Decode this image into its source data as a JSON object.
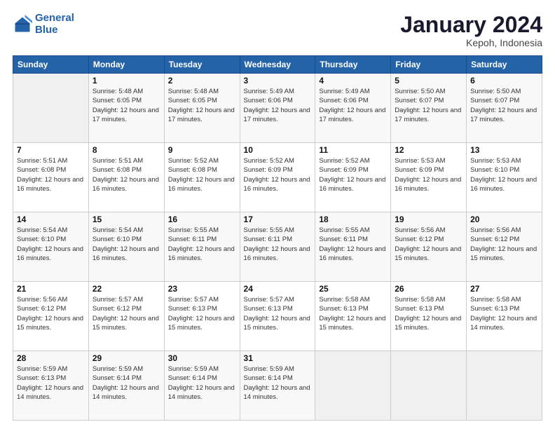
{
  "logo": {
    "line1": "General",
    "line2": "Blue"
  },
  "title": "January 2024",
  "subtitle": "Kepoh, Indonesia",
  "days_of_week": [
    "Sunday",
    "Monday",
    "Tuesday",
    "Wednesday",
    "Thursday",
    "Friday",
    "Saturday"
  ],
  "weeks": [
    [
      {
        "day": "",
        "info": ""
      },
      {
        "day": "1",
        "info": "Sunrise: 5:48 AM\nSunset: 6:05 PM\nDaylight: 12 hours\nand 17 minutes."
      },
      {
        "day": "2",
        "info": "Sunrise: 5:48 AM\nSunset: 6:05 PM\nDaylight: 12 hours\nand 17 minutes."
      },
      {
        "day": "3",
        "info": "Sunrise: 5:49 AM\nSunset: 6:06 PM\nDaylight: 12 hours\nand 17 minutes."
      },
      {
        "day": "4",
        "info": "Sunrise: 5:49 AM\nSunset: 6:06 PM\nDaylight: 12 hours\nand 17 minutes."
      },
      {
        "day": "5",
        "info": "Sunrise: 5:50 AM\nSunset: 6:07 PM\nDaylight: 12 hours\nand 17 minutes."
      },
      {
        "day": "6",
        "info": "Sunrise: 5:50 AM\nSunset: 6:07 PM\nDaylight: 12 hours\nand 17 minutes."
      }
    ],
    [
      {
        "day": "7",
        "info": "Sunrise: 5:51 AM\nSunset: 6:08 PM\nDaylight: 12 hours\nand 16 minutes."
      },
      {
        "day": "8",
        "info": "Sunrise: 5:51 AM\nSunset: 6:08 PM\nDaylight: 12 hours\nand 16 minutes."
      },
      {
        "day": "9",
        "info": "Sunrise: 5:52 AM\nSunset: 6:08 PM\nDaylight: 12 hours\nand 16 minutes."
      },
      {
        "day": "10",
        "info": "Sunrise: 5:52 AM\nSunset: 6:09 PM\nDaylight: 12 hours\nand 16 minutes."
      },
      {
        "day": "11",
        "info": "Sunrise: 5:52 AM\nSunset: 6:09 PM\nDaylight: 12 hours\nand 16 minutes."
      },
      {
        "day": "12",
        "info": "Sunrise: 5:53 AM\nSunset: 6:09 PM\nDaylight: 12 hours\nand 16 minutes."
      },
      {
        "day": "13",
        "info": "Sunrise: 5:53 AM\nSunset: 6:10 PM\nDaylight: 12 hours\nand 16 minutes."
      }
    ],
    [
      {
        "day": "14",
        "info": "Sunrise: 5:54 AM\nSunset: 6:10 PM\nDaylight: 12 hours\nand 16 minutes."
      },
      {
        "day": "15",
        "info": "Sunrise: 5:54 AM\nSunset: 6:10 PM\nDaylight: 12 hours\nand 16 minutes."
      },
      {
        "day": "16",
        "info": "Sunrise: 5:55 AM\nSunset: 6:11 PM\nDaylight: 12 hours\nand 16 minutes."
      },
      {
        "day": "17",
        "info": "Sunrise: 5:55 AM\nSunset: 6:11 PM\nDaylight: 12 hours\nand 16 minutes."
      },
      {
        "day": "18",
        "info": "Sunrise: 5:55 AM\nSunset: 6:11 PM\nDaylight: 12 hours\nand 16 minutes."
      },
      {
        "day": "19",
        "info": "Sunrise: 5:56 AM\nSunset: 6:12 PM\nDaylight: 12 hours\nand 15 minutes."
      },
      {
        "day": "20",
        "info": "Sunrise: 5:56 AM\nSunset: 6:12 PM\nDaylight: 12 hours\nand 15 minutes."
      }
    ],
    [
      {
        "day": "21",
        "info": "Sunrise: 5:56 AM\nSunset: 6:12 PM\nDaylight: 12 hours\nand 15 minutes."
      },
      {
        "day": "22",
        "info": "Sunrise: 5:57 AM\nSunset: 6:12 PM\nDaylight: 12 hours\nand 15 minutes."
      },
      {
        "day": "23",
        "info": "Sunrise: 5:57 AM\nSunset: 6:13 PM\nDaylight: 12 hours\nand 15 minutes."
      },
      {
        "day": "24",
        "info": "Sunrise: 5:57 AM\nSunset: 6:13 PM\nDaylight: 12 hours\nand 15 minutes."
      },
      {
        "day": "25",
        "info": "Sunrise: 5:58 AM\nSunset: 6:13 PM\nDaylight: 12 hours\nand 15 minutes."
      },
      {
        "day": "26",
        "info": "Sunrise: 5:58 AM\nSunset: 6:13 PM\nDaylight: 12 hours\nand 15 minutes."
      },
      {
        "day": "27",
        "info": "Sunrise: 5:58 AM\nSunset: 6:13 PM\nDaylight: 12 hours\nand 14 minutes."
      }
    ],
    [
      {
        "day": "28",
        "info": "Sunrise: 5:59 AM\nSunset: 6:13 PM\nDaylight: 12 hours\nand 14 minutes."
      },
      {
        "day": "29",
        "info": "Sunrise: 5:59 AM\nSunset: 6:14 PM\nDaylight: 12 hours\nand 14 minutes."
      },
      {
        "day": "30",
        "info": "Sunrise: 5:59 AM\nSunset: 6:14 PM\nDaylight: 12 hours\nand 14 minutes."
      },
      {
        "day": "31",
        "info": "Sunrise: 5:59 AM\nSunset: 6:14 PM\nDaylight: 12 hours\nand 14 minutes."
      },
      {
        "day": "",
        "info": ""
      },
      {
        "day": "",
        "info": ""
      },
      {
        "day": "",
        "info": ""
      }
    ]
  ]
}
